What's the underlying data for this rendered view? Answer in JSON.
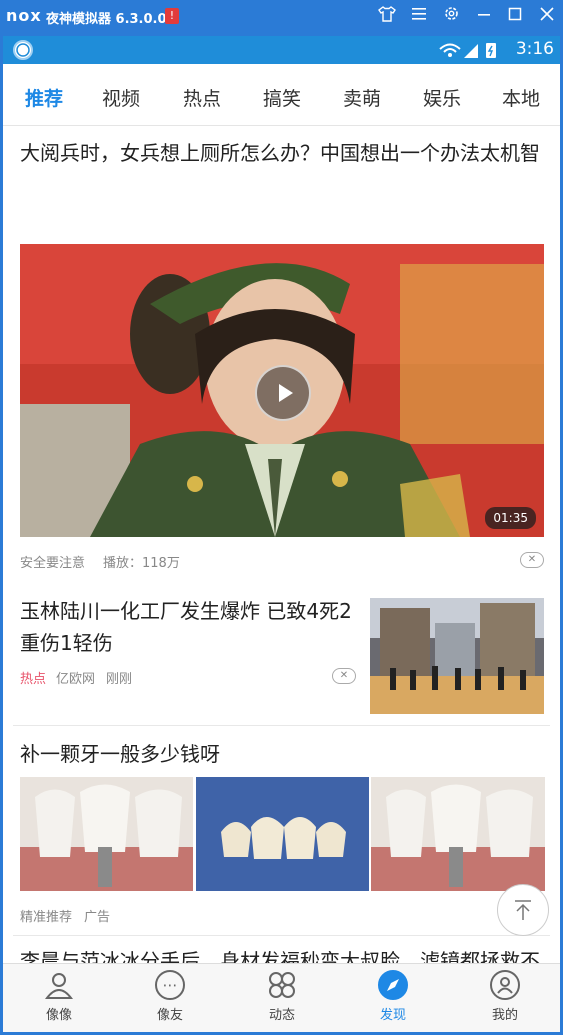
{
  "emulator": {
    "logo": "nox",
    "title": "夜神模拟器 6.3.0.0",
    "warn_icon": "!",
    "controls": [
      "shirt-icon",
      "menu-icon",
      "gear-icon",
      "minimize-icon",
      "maximize-icon",
      "close-icon"
    ]
  },
  "statusbar": {
    "time": "3:16",
    "icons": "wifi-icon signal-icon battery-icon"
  },
  "tabs": [
    "推荐",
    "视频",
    "热点",
    "搞笑",
    "卖萌",
    "娱乐",
    "本地"
  ],
  "active_tab": "推荐",
  "feed": {
    "items": [
      {
        "title": "大阅兵时，女兵想上厕所怎么办？中国想出一个办法太机智",
        "duration": "01:35",
        "source": "安全要注意",
        "plays": "播放：118万"
      },
      {
        "title": "玉林陆川一化工厂发生爆炸 已致4死2重伤1轻伤",
        "tag": "热点",
        "source": "亿欧网",
        "time": "刚刚"
      },
      {
        "title": "补一颗牙一般多少钱呀",
        "source": "精准推荐",
        "tag": "广告"
      },
      {
        "title": "李晨与范冰冰分手后，身材发福秒变大叔脸，滤镜都拯救不了他！"
      }
    ]
  },
  "bottom_nav": [
    {
      "label": "像像",
      "icon": "people-icon"
    },
    {
      "label": "像友",
      "icon": "chat-icon"
    },
    {
      "label": "动态",
      "icon": "clover-icon"
    },
    {
      "label": "发现",
      "icon": "compass-icon"
    },
    {
      "label": "我的",
      "icon": "user-icon"
    }
  ],
  "active_nav": "发现",
  "colors": {
    "accent": "#1e88e5",
    "emulator_frame": "#2b7bd6",
    "hot_tag": "#e8536a"
  }
}
